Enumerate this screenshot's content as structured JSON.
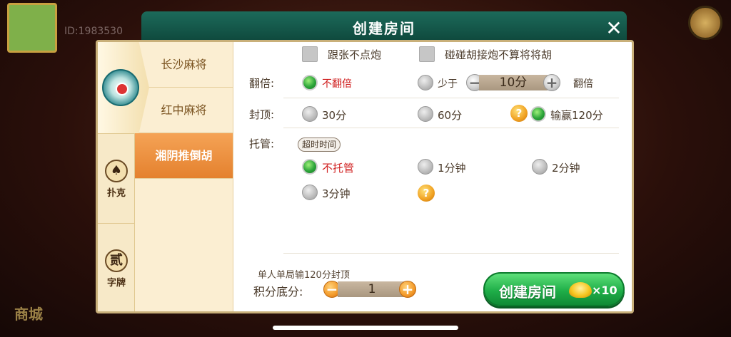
{
  "background": {
    "user_id": "ID:1983530",
    "shop_label": "商城"
  },
  "dialog": {
    "title": "创建房间",
    "close_symbol": "✕"
  },
  "categories": [
    {
      "label": "",
      "icon": "mahjong-icon"
    },
    {
      "label": "扑克",
      "icon": "spade-icon",
      "glyph": "♠"
    },
    {
      "label": "字牌",
      "icon": "zipai-icon",
      "glyph": "贰"
    }
  ],
  "games": [
    {
      "label": "长沙麻将",
      "active": false
    },
    {
      "label": "红中麻将",
      "active": false
    },
    {
      "label": "湘阴推倒胡",
      "active": true
    }
  ],
  "options": {
    "follow_no_pao": "跟张不点炮",
    "pengpeng_rule": "碰碰胡接炮不算将将胡",
    "double_label": "翻倍:",
    "no_double": "不翻倍",
    "less_than": "少于",
    "double_threshold": "10分",
    "double_suffix": "翻倍",
    "cap_label": "封顶:",
    "cap_30": "30分",
    "cap_60": "60分",
    "cap_120": "输赢120分",
    "host_label": "托管:",
    "timeout_tag": "超时时间",
    "host_none": "不托管",
    "host_1": "1分钟",
    "host_2": "2分钟",
    "host_3": "3分钟",
    "question_mark": "?"
  },
  "footer": {
    "note": "单人单局输120分封顶",
    "score_label": "积分底分:",
    "score_value": "1",
    "create_label": "创建房间",
    "cost": "×10"
  }
}
